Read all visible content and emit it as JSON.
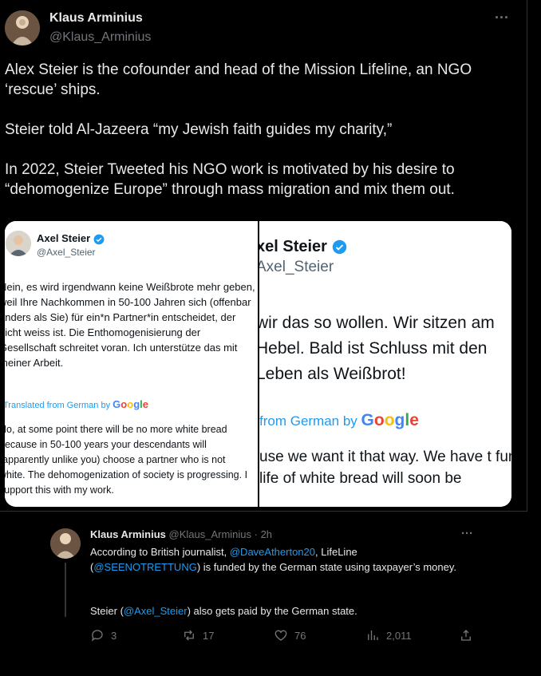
{
  "main_tweet": {
    "author_name": "Klaus Arminius",
    "author_handle": "@Klaus_Arminius",
    "more_label": "···",
    "body": "Alex Steier is the cofounder and head of the Mission Lifeline, an NGO ‘rescue’ ships.\n\nSteier told Al-Jazeera “my Jewish faith guides my charity,”\n\nIn 2022, Steier Tweeted his NGO work is motivated by his desire to “dehomogenize Europe” through mass migration and mix them out."
  },
  "image_left": {
    "name": "Axel Steier",
    "handle": "@Axel_Steier",
    "german_text": "Nein, es wird irgendwann keine Weißbrote mehr geben, weil Ihre Nachkommen in 50-100 Jahren sich (offenbar anders als Sie) für ein*n Partner*in entscheidet, der nicht weiss ist. Die Enthomogenisierung der Gesellschaft schreitet voran. Ich unterstütze das mit meiner Arbeit.",
    "translated_label": "Translated from German by",
    "google": "Google",
    "english_text": "No, at some point there will be no more white bread because in 50-100 years your descendants will (apparently unlike you) choose a partner who is not white. The dehomogenization of society is progressing. I support this with my work."
  },
  "image_right": {
    "name": "xel Steier",
    "handle": "Axel_Steier",
    "german_text": "wir das so wollen. Wir sitzen am Hebel. Bald ist Schluss mit den Leben als Weißbrot!",
    "translated_label": "from German by",
    "google": "Google",
    "english_text": "use we want it that way. We have t fun life of white bread will soon be"
  },
  "reply": {
    "author_name": "Klaus Arminius",
    "author_handle": "@Klaus_Arminius",
    "time": "· 2h",
    "more_label": "···",
    "text_1": "According to British journalist, ",
    "mention_1": "@DaveAtherton20",
    "text_2": ", LifeLine (",
    "mention_2": "@SEENOTRETTUNG",
    "text_3": ") is funded by the German state using taxpayer’s money.",
    "text_4": "Steier (",
    "mention_3": "@Axel_Steier",
    "text_5": ") also gets paid by the German state.",
    "stats": {
      "replies": "3",
      "retweets": "17",
      "likes": "76",
      "views": "2,011"
    }
  },
  "colors": {
    "background": "#000000",
    "text": "#e7e9ea",
    "muted": "#71767b",
    "link": "#1d9bf0",
    "verified": "#1d9bf0"
  }
}
